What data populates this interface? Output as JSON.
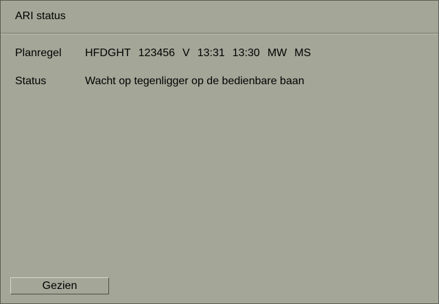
{
  "window": {
    "title": "ARI status"
  },
  "planregel": {
    "label": "Planregel",
    "fields": [
      "HFDGHT",
      "123456",
      "V",
      "13:31",
      "13:30",
      "MW",
      "MS"
    ]
  },
  "status": {
    "label": "Status",
    "value": "Wacht op tegenligger op de bedienbare baan"
  },
  "buttons": {
    "acknowledge_label": "Gezien"
  },
  "colors": {
    "panel_background": "#a4a698",
    "text": "#000000"
  }
}
